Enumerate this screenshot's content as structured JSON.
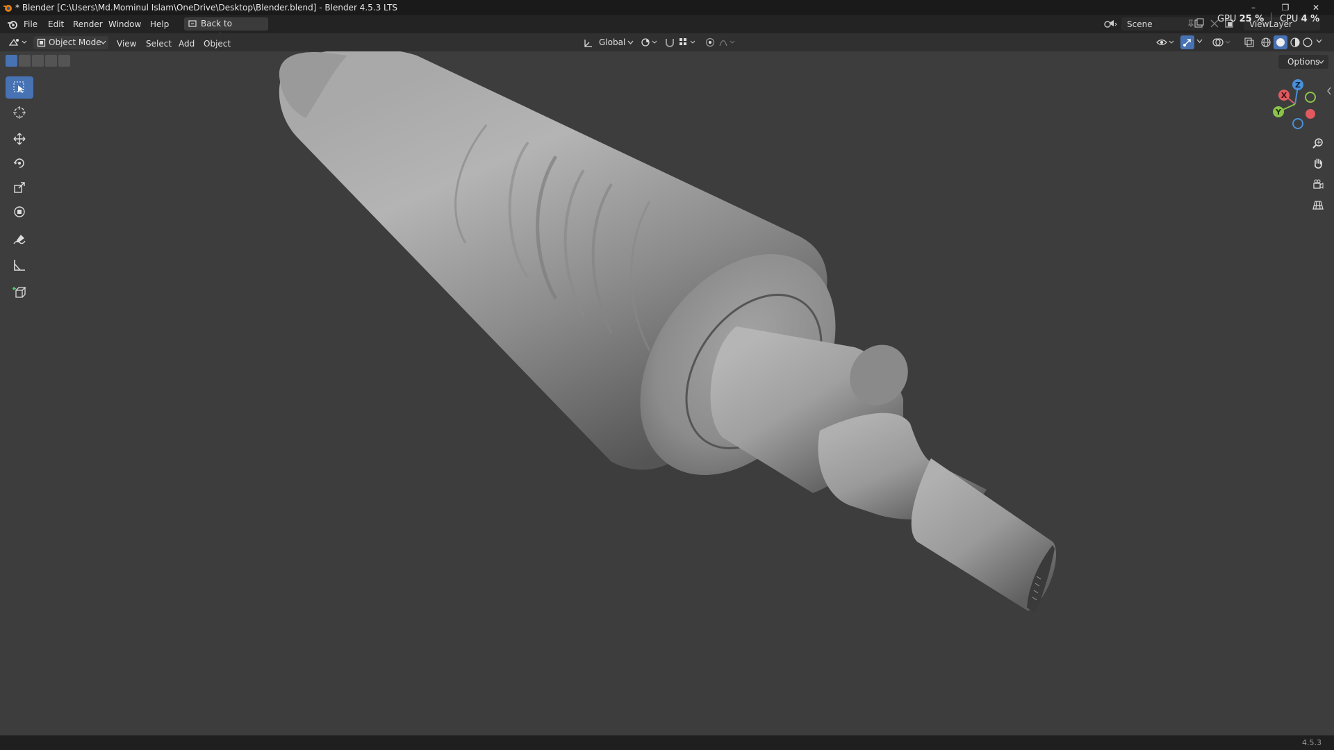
{
  "window": {
    "title": "* Blender [C:\\Users\\Md.Mominul Islam\\OneDrive\\Desktop\\Blender.blend] - Blender 4.5.3 LTS",
    "minimize": "–",
    "maximize": "❐",
    "close": "✕"
  },
  "stats": {
    "gpu_label": "GPU",
    "gpu_value": "25 %",
    "cpu_label": "CPU",
    "cpu_value": "4 %"
  },
  "topbar": {
    "menus": [
      "File",
      "Edit",
      "Render",
      "Window",
      "Help"
    ],
    "back_button": "Back to Previous",
    "scene": "Scene",
    "view_layer": "ViewLayer"
  },
  "header": {
    "mode": "Object Mode",
    "menus": [
      "View",
      "Select",
      "Add",
      "Object"
    ],
    "transform_orientation": "Global",
    "options": "Options"
  },
  "gizmo": {
    "x_label": "X",
    "y_label": "Y",
    "z_label": "Z",
    "x_color": "#e05a5f",
    "y_color": "#8bc34a",
    "z_color": "#4a90d9"
  },
  "tools": [
    "select-box",
    "cursor",
    "move",
    "rotate",
    "scale",
    "transform",
    "annotate",
    "measure",
    "add-cube"
  ],
  "status": {
    "version": "4.5.3"
  },
  "colors": {
    "accent": "#4772b3",
    "viewport_bg": "#3d3d3d"
  }
}
